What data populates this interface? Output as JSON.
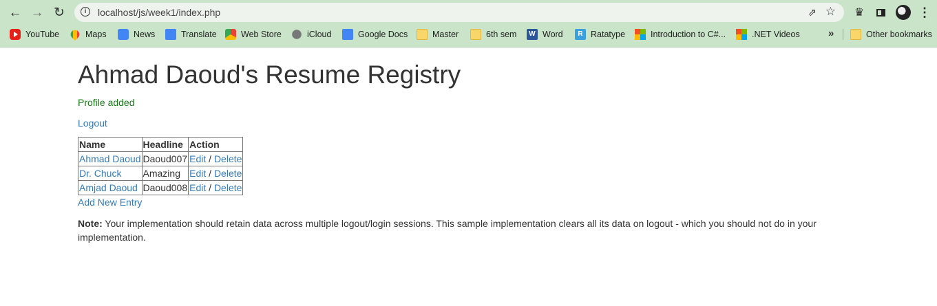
{
  "browser": {
    "url": "localhost/js/week1/index.php",
    "bookmarks": [
      {
        "label": "YouTube",
        "icon": "youtube-icon"
      },
      {
        "label": "Maps",
        "icon": "maps-icon"
      },
      {
        "label": "News",
        "icon": "news-icon"
      },
      {
        "label": "Translate",
        "icon": "translate-icon"
      },
      {
        "label": "Web Store",
        "icon": "webstore-icon"
      },
      {
        "label": "iCloud",
        "icon": "apple-icon"
      },
      {
        "label": "Google Docs",
        "icon": "docs-icon"
      },
      {
        "label": "Master",
        "icon": "folder-icon"
      },
      {
        "label": "6th sem",
        "icon": "folder-icon"
      },
      {
        "label": "Word",
        "icon": "word-icon"
      },
      {
        "label": "Ratatype",
        "icon": "ratatype-icon"
      },
      {
        "label": "Introduction to C#...",
        "icon": "microsoft-icon"
      },
      {
        "label": ".NET Videos",
        "icon": "microsoft-icon"
      }
    ],
    "other_bookmarks": "Other bookmarks",
    "chrome_color": "#c9e4c9"
  },
  "page": {
    "title": "Ahmad Daoud's Resume Registry",
    "flash": "Profile added",
    "flash_color": "#1a7a1a",
    "logout": "Logout",
    "table": {
      "headers": [
        "Name",
        "Headline",
        "Action"
      ],
      "rows": [
        {
          "name": "Ahmad Daoud",
          "headline": "Daoud007",
          "edit": "Edit",
          "sep": "/",
          "delete": "Delete"
        },
        {
          "name": "Dr. Chuck",
          "headline": "Amazing",
          "edit": "Edit",
          "sep": "/",
          "delete": "Delete"
        },
        {
          "name": "Amjad Daoud",
          "headline": "Daoud008",
          "edit": "Edit",
          "sep": "/",
          "delete": "Delete"
        }
      ]
    },
    "add_new": "Add New Entry",
    "note_label": "Note:",
    "note_text": " Your implementation should retain data across multiple logout/login sessions. This sample implementation clears all its data on logout - which you should not do in your implementation.",
    "link_color": "#337ab7"
  }
}
